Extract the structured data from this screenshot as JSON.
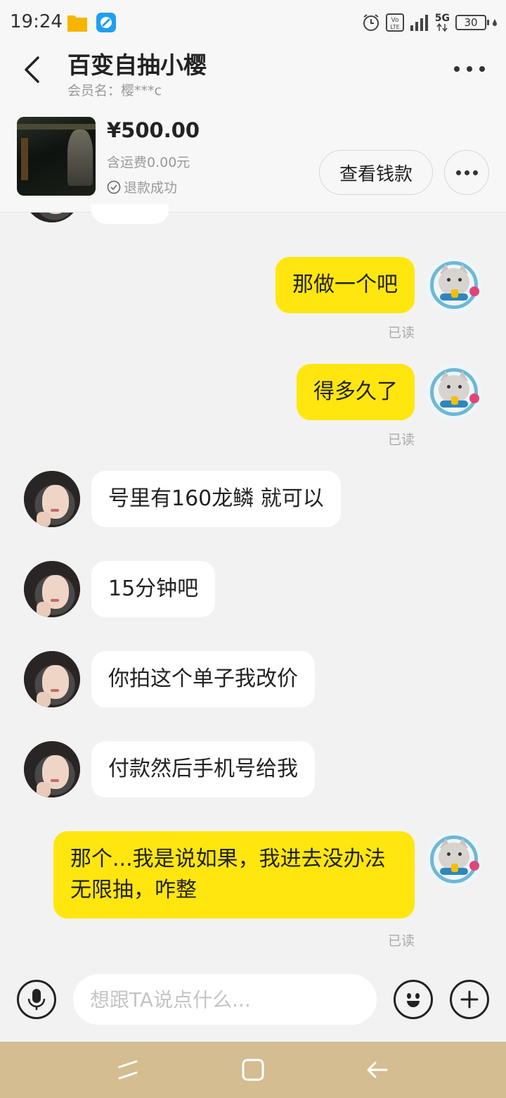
{
  "status_bar": {
    "time": "19:24",
    "network": "5G",
    "battery": "30"
  },
  "header": {
    "title": "百变自抽小樱",
    "subtitle": "会员名：樱***c"
  },
  "order": {
    "price": "¥500.00",
    "shipping": "含运费0.00元",
    "refund_status": "退款成功",
    "view_button": "查看钱款"
  },
  "messages": [
    {
      "side": "out",
      "text": "那做一个吧",
      "status": "已读"
    },
    {
      "side": "out",
      "text": "得多久了",
      "status": "已读"
    },
    {
      "side": "in",
      "text": "号里有160龙鳞 就可以"
    },
    {
      "side": "in",
      "text": "15分钟吧"
    },
    {
      "side": "in",
      "text": "你拍这个单子我改价"
    },
    {
      "side": "in",
      "text": "付款然后手机号给我"
    },
    {
      "side": "out",
      "text": "那个...我是说如果，我进去没办法无限抽，咋整",
      "status": "已读"
    }
  ],
  "input": {
    "placeholder": "想跟TA说点什么..."
  },
  "icons": {
    "back": "chevron-left-icon",
    "more": "more-icon",
    "voice": "microphone-icon",
    "emoji": "emoji-icon",
    "plus": "plus-icon",
    "recent": "recent-apps-icon",
    "home": "home-icon",
    "nav_back": "nav-back-icon"
  },
  "colors": {
    "out_bubble": "#ffe60f",
    "in_bubble": "#ffffff",
    "nav_bar": "#d3bd91"
  }
}
